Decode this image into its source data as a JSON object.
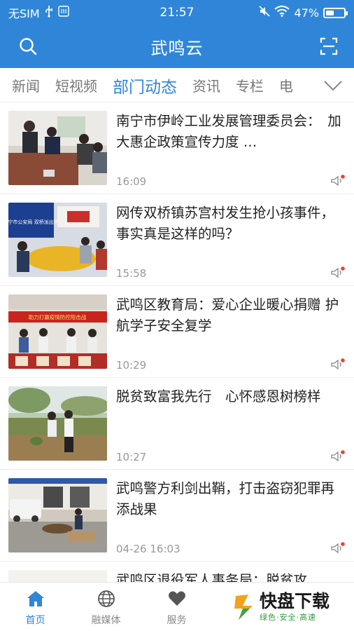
{
  "status": {
    "carrier": "无SIM",
    "time": "21:57",
    "battery": "47%",
    "battery_level": 0.47
  },
  "header": {
    "title": "武鸣云",
    "left_icon": "search-icon",
    "right_icon": "scan-icon"
  },
  "tabs": {
    "items": [
      "新闻",
      "短视频",
      "部门动态",
      "资讯",
      "专栏",
      "电"
    ],
    "active_index": 2,
    "expand_icon": "chevron-down-icon"
  },
  "news": [
    {
      "title": "南宁市伊岭工业发展管理委员会：　加大惠企政策宣传力度 …",
      "time": "16:09"
    },
    {
      "title": "网传双桥镇苏宫村发生抢小孩事件，事实真是这样的吗？",
      "time": "15:58"
    },
    {
      "title": "武鸣区教育局：爱心企业暖心捐赠 护航学子安全复学",
      "time": "10:29"
    },
    {
      "title": "脱贫致富我先行　心怀感恩树榜样",
      "time": "10:27"
    },
    {
      "title": "武鸣警方利剑出鞘，打击盗窃犯罪再添战果",
      "time": "04-26 16:03"
    },
    {
      "title": "武鸣区退役军人事务局：脱贫攻",
      "time": ""
    }
  ],
  "thumb_texts": {
    "item2_sign": "南宁市公安局 双桥派出所",
    "item3_banner": "助力打赢疫情防控阻击战"
  },
  "bottom_nav": [
    {
      "label": "首页",
      "icon": "home-icon",
      "active": true
    },
    {
      "label": "融媒体",
      "icon": "globe-icon",
      "active": false
    },
    {
      "label": "服务",
      "icon": "heart-icon",
      "active": false
    }
  ],
  "watermark": {
    "main": "快盘下载",
    "sub": "绿色·安全·高速"
  },
  "colors": {
    "brand": "#2f86d8",
    "badge_red": "#e8433a"
  }
}
